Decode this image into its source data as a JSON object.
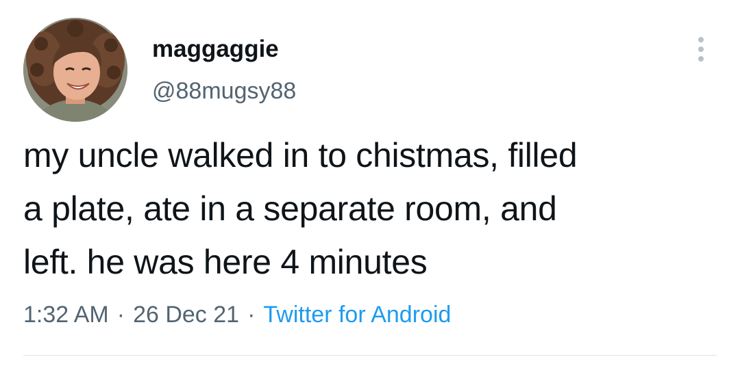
{
  "author": {
    "display_name": "maggaggie",
    "handle": "@88mugsy88",
    "avatar_icon": "profile-photo"
  },
  "tweet": {
    "text_lines": [
      "my uncle walked in to chistmas, filled",
      "a plate, ate in a separate room, and",
      "left. he was here 4 minutes"
    ],
    "time": "1:32 AM",
    "separator": "·",
    "date": "26 Dec 21",
    "source": "Twitter for Android"
  },
  "icons": {
    "more": "more-vertical-icon"
  },
  "colors": {
    "text": "#0f1419",
    "secondary_text": "#536471",
    "link": "#1d9bf0",
    "divider": "#dfe3e6"
  }
}
